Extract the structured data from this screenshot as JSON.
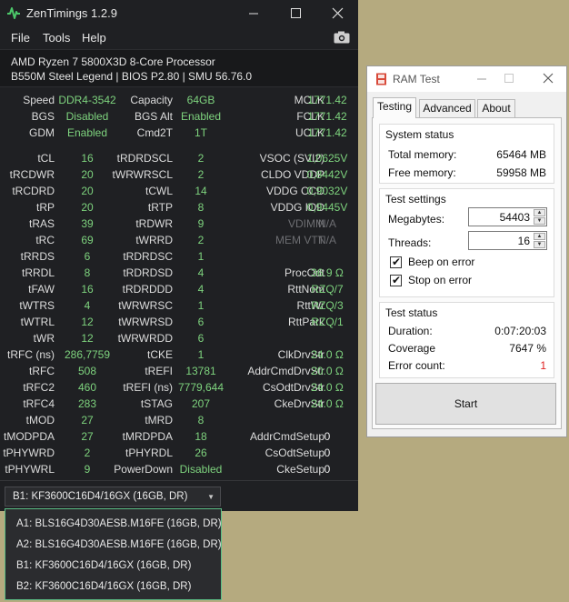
{
  "zentimings": {
    "title": "ZenTimings 1.2.9",
    "menu": [
      "File",
      "Tools",
      "Help"
    ],
    "cpu": "AMD Ryzen 7 5800X3D 8-Core Processor",
    "board": "B550M Steel Legend | BIOS P2.80 | SMU 56.76.0",
    "top_rows": [
      [
        [
          "Speed",
          "DDR4-3542"
        ],
        [
          "Capacity",
          "64GB"
        ],
        [
          "MCLK",
          "1771.42"
        ]
      ],
      [
        [
          "BGS",
          "Disabled"
        ],
        [
          "BGS Alt",
          "Enabled"
        ],
        [
          "FCLK",
          "1771.42"
        ]
      ],
      [
        [
          "GDM",
          "Enabled"
        ],
        [
          "Cmd2T",
          "1T"
        ],
        [
          "UCLK",
          "1771.42"
        ]
      ]
    ],
    "timing_rows": [
      [
        [
          "tCL",
          "16"
        ],
        [
          "tRDRDSCL",
          "2"
        ],
        [
          "VSOC (SVI2)",
          "1,0625V"
        ]
      ],
      [
        [
          "tRCDWR",
          "20"
        ],
        [
          "tWRWRSCL",
          "2"
        ],
        [
          "CLDO VDDP",
          "0,8442V"
        ]
      ],
      [
        [
          "tRCDRD",
          "20"
        ],
        [
          "tCWL",
          "14"
        ],
        [
          "VDDG CCD",
          "0,9032V"
        ]
      ],
      [
        [
          "tRP",
          "20"
        ],
        [
          "tRTP",
          "8"
        ],
        [
          "VDDG IOD",
          "0,9445V"
        ]
      ],
      [
        [
          "tRAS",
          "39"
        ],
        [
          "tRDWR",
          "9"
        ],
        [
          "VDIMM",
          "N/A"
        ]
      ],
      [
        [
          "tRC",
          "69"
        ],
        [
          "tWRRD",
          "2"
        ],
        [
          "MEM VTT",
          "N/A"
        ]
      ],
      [
        [
          "tRRDS",
          "6"
        ],
        [
          "tRDRDSC",
          "1"
        ],
        [
          "",
          ""
        ]
      ],
      [
        [
          "tRRDL",
          "8"
        ],
        [
          "tRDRDSD",
          "4"
        ],
        [
          "ProcOdt",
          "36.9 Ω"
        ]
      ],
      [
        [
          "tFAW",
          "16"
        ],
        [
          "tRDRDDD",
          "4"
        ],
        [
          "RttNom",
          "RZQ/7"
        ]
      ],
      [
        [
          "tWTRS",
          "4"
        ],
        [
          "tWRWRSC",
          "1"
        ],
        [
          "RttWr",
          "RZQ/3"
        ]
      ],
      [
        [
          "tWTRL",
          "12"
        ],
        [
          "tWRWRSD",
          "6"
        ],
        [
          "RttPark",
          "RZQ/1"
        ]
      ],
      [
        [
          "tWR",
          "12"
        ],
        [
          "tWRWRDD",
          "6"
        ],
        [
          "",
          ""
        ]
      ],
      [
        [
          "tRFC (ns)",
          "286,7759"
        ],
        [
          "tCKE",
          "1"
        ],
        [
          "ClkDrvStr",
          "24.0 Ω"
        ]
      ],
      [
        [
          "tRFC",
          "508"
        ],
        [
          "tREFI",
          "13781"
        ],
        [
          "AddrCmdDrvStr",
          "20.0 Ω"
        ]
      ],
      [
        [
          "tRFC2",
          "460"
        ],
        [
          "tREFI (ns)",
          "7779,644"
        ],
        [
          "CsOdtDrvStr",
          "24.0 Ω"
        ]
      ],
      [
        [
          "tRFC4",
          "283"
        ],
        [
          "tSTAG",
          "207"
        ],
        [
          "CkeDrvStr",
          "24.0 Ω"
        ]
      ],
      [
        [
          "tMOD",
          "27"
        ],
        [
          "tMRD",
          "8"
        ],
        [
          "",
          ""
        ]
      ],
      [
        [
          "tMODPDA",
          "27"
        ],
        [
          "tMRDPDA",
          "18"
        ],
        [
          "AddrCmdSetup",
          "0"
        ]
      ],
      [
        [
          "tPHYWRD",
          "2"
        ],
        [
          "tPHYRDL",
          "26"
        ],
        [
          "CsOdtSetup",
          "0"
        ]
      ],
      [
        [
          "tPHYWRL",
          "9"
        ],
        [
          "PowerDown",
          "Disabled"
        ],
        [
          "CkeSetup",
          "0"
        ]
      ]
    ],
    "dim_labels": [
      "VDIMM",
      "MEM VTT"
    ],
    "white_values": [
      "AddrCmdSetup",
      "CsOdtSetup",
      "CkeSetup"
    ],
    "selected_module": "B1: KF3600C16D4/16GX (16GB, DR)",
    "modules": [
      "A1: BLS16G4D30AESB.M16FE (16GB, DR)",
      "A2: BLS16G4D30AESB.M16FE (16GB, DR)",
      "B1: KF3600C16D4/16GX (16GB, DR)",
      "B2: KF3600C16D4/16GX (16GB, DR)"
    ],
    "colors": {
      "background": "#1f2023",
      "value_green": "#7ed37e",
      "accent_border": "#5bbf86"
    }
  },
  "ramtest": {
    "title": "RAM Test",
    "tabs": [
      "Testing",
      "Advanced",
      "About"
    ],
    "system_status": {
      "title": "System status",
      "total_memory_label": "Total memory:",
      "total_memory": "65464 MB",
      "free_memory_label": "Free memory:",
      "free_memory": "59958 MB"
    },
    "test_settings": {
      "title": "Test settings",
      "megabytes_label": "Megabytes:",
      "megabytes": "54403",
      "threads_label": "Threads:",
      "threads": "16",
      "beep_label": "Beep on error",
      "stop_label": "Stop on error"
    },
    "test_status": {
      "title": "Test status",
      "duration_label": "Duration:",
      "duration": "0:07:20:03",
      "coverage_label": "Coverage",
      "coverage": "7647 %",
      "errors_label": "Error count:",
      "errors": "1"
    },
    "start_label": "Start",
    "colors": {
      "error_red": "#e02020"
    }
  }
}
